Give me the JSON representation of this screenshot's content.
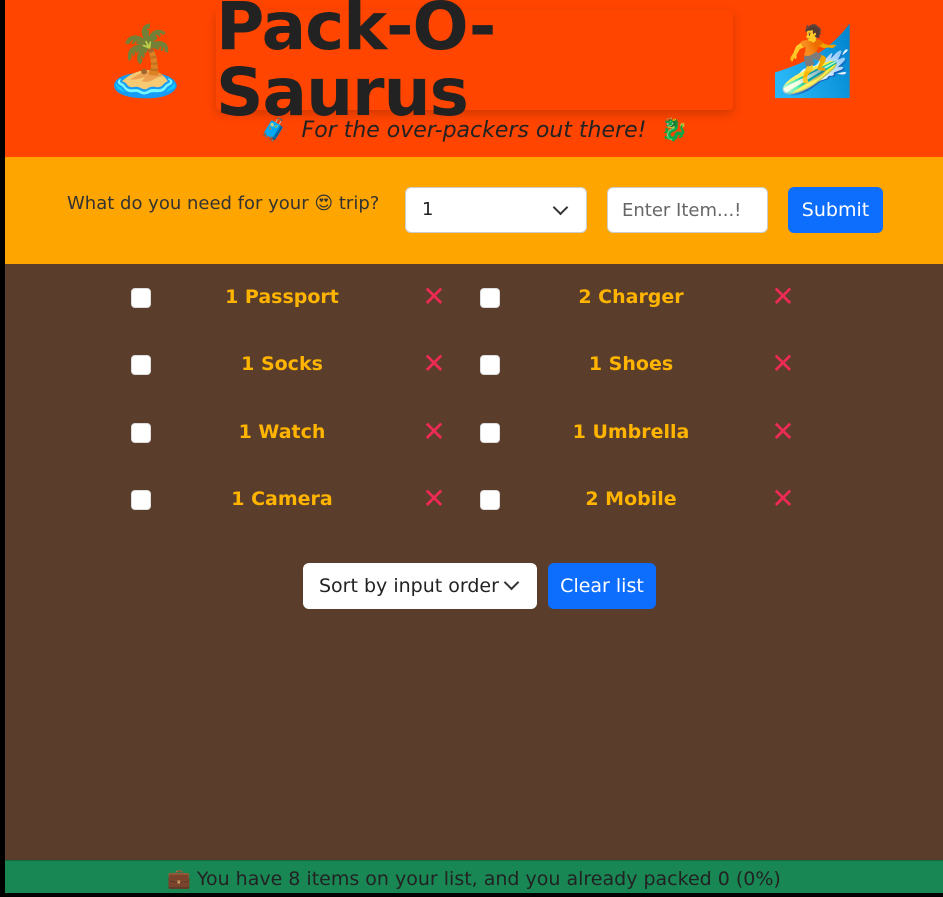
{
  "header": {
    "left_emoji": "🏝️",
    "title": "Pack-O-Saurus",
    "right_emoji": "🏄",
    "subtitle_prefix_emoji": "🧳",
    "subtitle": "For the over-packers out there!",
    "subtitle_suffix_emoji": "🐉"
  },
  "form": {
    "question_prefix": "What do you need for your",
    "question_emoji": "😍",
    "question_suffix": "trip?",
    "quantity_value": "1",
    "item_placeholder": "Enter Item...!",
    "submit_label": "Submit"
  },
  "items": [
    {
      "label": "1 Passport",
      "packed": false,
      "delete_icon": "✕"
    },
    {
      "label": "2 Charger",
      "packed": false,
      "delete_icon": "✕"
    },
    {
      "label": "1 Socks",
      "packed": false,
      "delete_icon": "✕"
    },
    {
      "label": "1 Shoes",
      "packed": false,
      "delete_icon": "✕"
    },
    {
      "label": "1 Watch",
      "packed": false,
      "delete_icon": "✕"
    },
    {
      "label": "1 Umbrella",
      "packed": false,
      "delete_icon": "✕"
    },
    {
      "label": "1 Camera",
      "packed": false,
      "delete_icon": "✕"
    },
    {
      "label": "2 Mobile",
      "packed": false,
      "delete_icon": "✕"
    }
  ],
  "actions": {
    "sort_value": "Sort by input order",
    "clear_label": "Clear list"
  },
  "footer": {
    "emoji": "💼",
    "text": "You have 8 items on your list, and you already packed 0 (0%)"
  },
  "colors": {
    "header_bg": "#ff4500",
    "form_bg": "#ffa500",
    "list_bg": "#5a3d2b",
    "item_text": "#ffb400",
    "delete": "#ee2a55",
    "button_blue": "#0d6efd",
    "footer_bg": "#198754"
  }
}
